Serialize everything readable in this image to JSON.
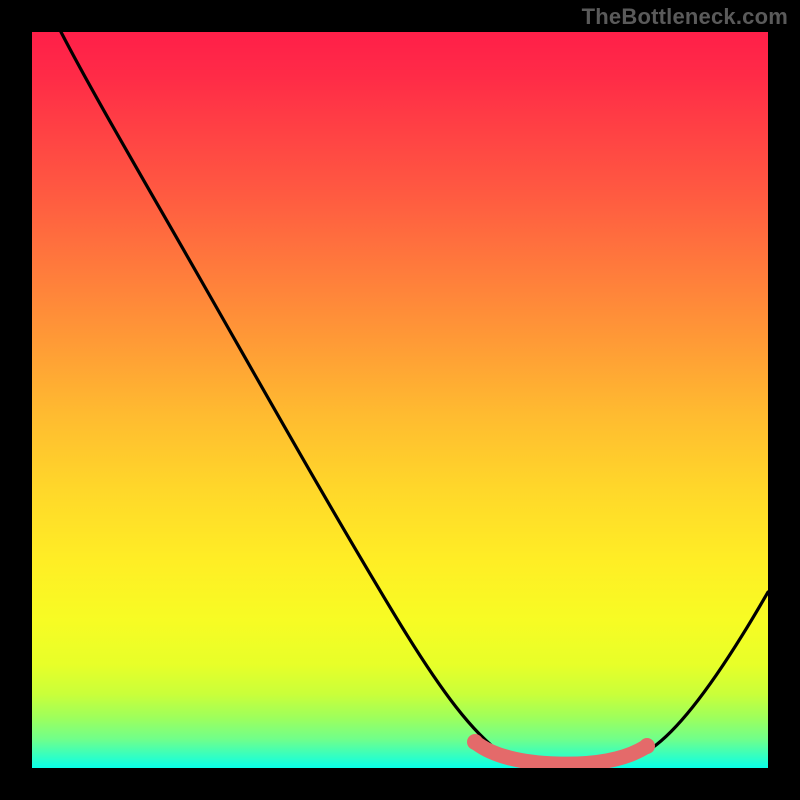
{
  "watermark": "TheBottleneck.com",
  "chart_data": {
    "type": "line",
    "title": "",
    "xlabel": "",
    "ylabel": "",
    "xlim": [
      0,
      100
    ],
    "ylim": [
      0,
      100
    ],
    "series": [
      {
        "name": "black-curve",
        "color": "#000000",
        "x": [
          4,
          10,
          20,
          30,
          40,
          50,
          55,
          60,
          65,
          70,
          74,
          78,
          82,
          88,
          94,
          100
        ],
        "y": [
          100,
          90,
          74,
          58,
          42,
          26,
          18,
          10,
          4,
          1,
          0,
          0,
          1,
          6,
          16,
          30
        ]
      },
      {
        "name": "pink-band",
        "color": "#e46a6a",
        "x": [
          60,
          64,
          68,
          72,
          76,
          80,
          84
        ],
        "y": [
          3.5,
          1.5,
          0.9,
          0.7,
          0.8,
          1.3,
          3.1
        ]
      }
    ],
    "gradient_stops": [
      {
        "pos": 0,
        "color": "#ff1f49"
      },
      {
        "pos": 50,
        "color": "#ffbb30"
      },
      {
        "pos": 80,
        "color": "#f7fc24"
      },
      {
        "pos": 100,
        "color": "#09ffe8"
      }
    ]
  }
}
